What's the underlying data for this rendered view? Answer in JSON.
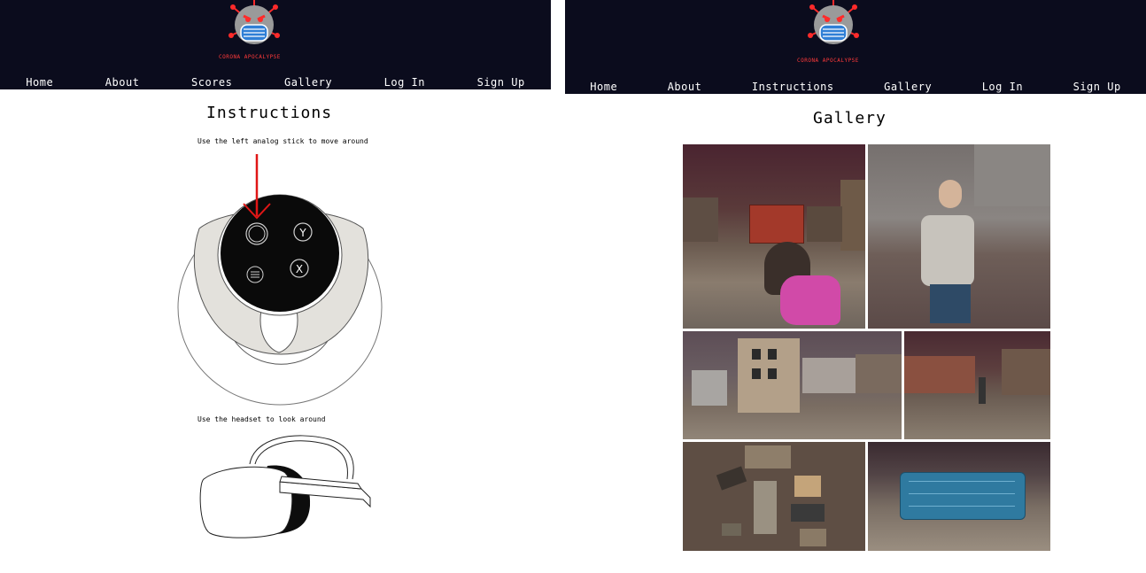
{
  "left": {
    "brand": "CORONA APOCALYPSE",
    "nav": [
      "Home",
      "About",
      "Scores",
      "Gallery",
      "Log In",
      "Sign Up"
    ],
    "title": "Instructions",
    "step1": "Use the left analog stick to move around",
    "step2": "Use the headset to look around",
    "controller": {
      "button_y": "Y",
      "button_x": "X"
    }
  },
  "right": {
    "brand": "CORONA APOCALYPSE",
    "nav": [
      "Home",
      "About",
      "Instructions",
      "Gallery",
      "Log In",
      "Sign Up"
    ],
    "title": "Gallery"
  },
  "colors": {
    "header_bg": "#0b0c1d",
    "brand_red": "#ff3a3a",
    "arrow_red": "#e01616"
  }
}
